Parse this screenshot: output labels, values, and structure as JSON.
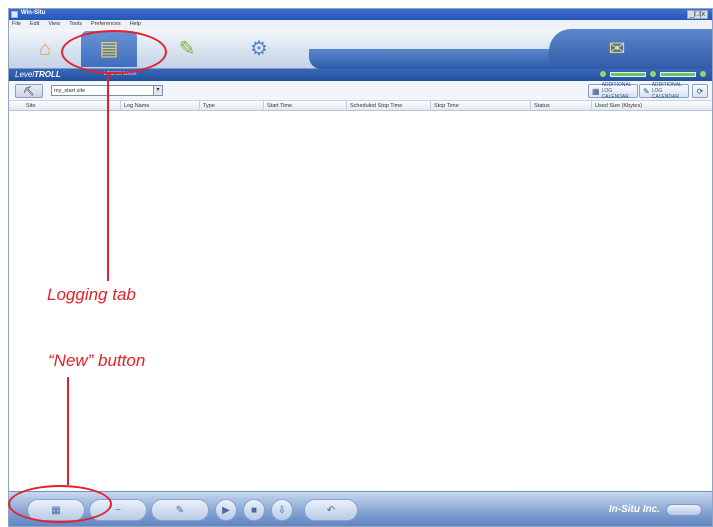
{
  "window": {
    "title": "Win-Situ",
    "controls": "_|□|x"
  },
  "menu": [
    "File",
    "Edit",
    "View",
    "Tools",
    "Preferences",
    "Help"
  ],
  "tabs": [
    {
      "name": "home",
      "icon": "home-icon",
      "glyph": "⌂"
    },
    {
      "name": "logging",
      "icon": "logging-icon",
      "glyph": "▤"
    },
    {
      "name": "data",
      "icon": "data-icon",
      "glyph": "✎"
    },
    {
      "name": "settings",
      "icon": "settings-icon",
      "glyph": "⚙"
    },
    {
      "name": "notes",
      "icon": "notes-icon",
      "glyph": "✉"
    }
  ],
  "brand": {
    "name_italic": "Level",
    "name_bold": "TROLL",
    "subtitle": "LTS/02/18/02"
  },
  "toolbar": {
    "site_button_glyph": "⛏",
    "site_select_value": "my_start site",
    "action1_label": "ADDITIONAL LOG CALENDAR",
    "action2_label": "ADDITIONAL LOG CALENDAR"
  },
  "table": {
    "columns": [
      "Site",
      "Log Name",
      "Type",
      "Start Time",
      "Scheduled Stop Time",
      "Stop Time",
      "Status",
      "Used Size (Kbytes)"
    ]
  },
  "bottom": {
    "new_glyph": "▦",
    "brand": "In-Situ Inc."
  },
  "annotations": {
    "logging_tab": "Logging tab",
    "new_button": "“New” button"
  },
  "colors": {
    "annotation": "#e3212c",
    "accent": "#2f5ba8"
  }
}
